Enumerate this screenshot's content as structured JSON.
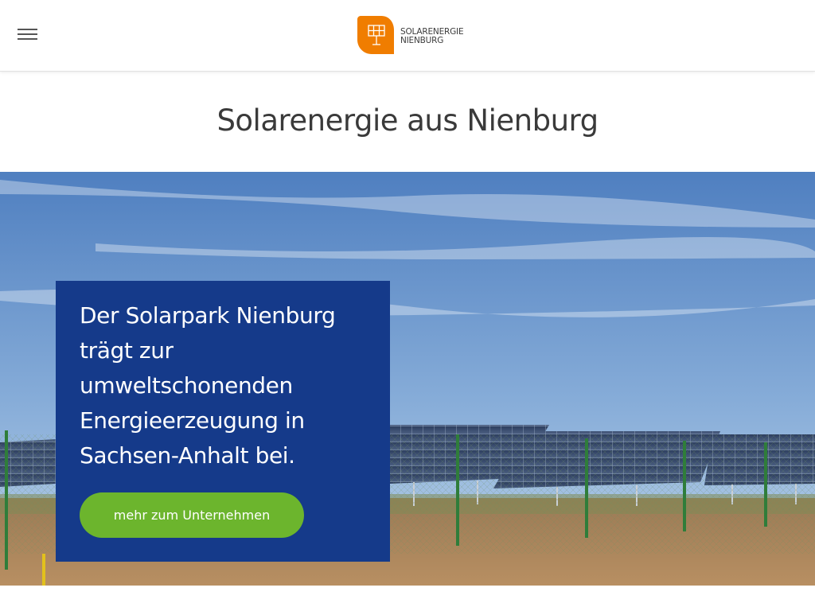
{
  "header": {
    "logo": {
      "line1": "SOLARENERGIE",
      "line2": "NIENBURG",
      "mark_icon": "solar-panel-leaf-icon",
      "brand_color": "#f07d00"
    },
    "menu_icon": "hamburger-menu-icon"
  },
  "main": {
    "title": "Solarenergie aus Nienburg"
  },
  "hero": {
    "image_subject": "solar-park-field-icon",
    "card": {
      "lines": [
        "Der Solarpark Nienburg",
        "trägt zur",
        "umweltschonenden",
        "Energieerzeugung in",
        "Sachsen-Anhalt bei."
      ],
      "cta_label": "mehr zum Unternehmen",
      "card_color": "#153a8a",
      "cta_color": "#6cb52d"
    }
  }
}
